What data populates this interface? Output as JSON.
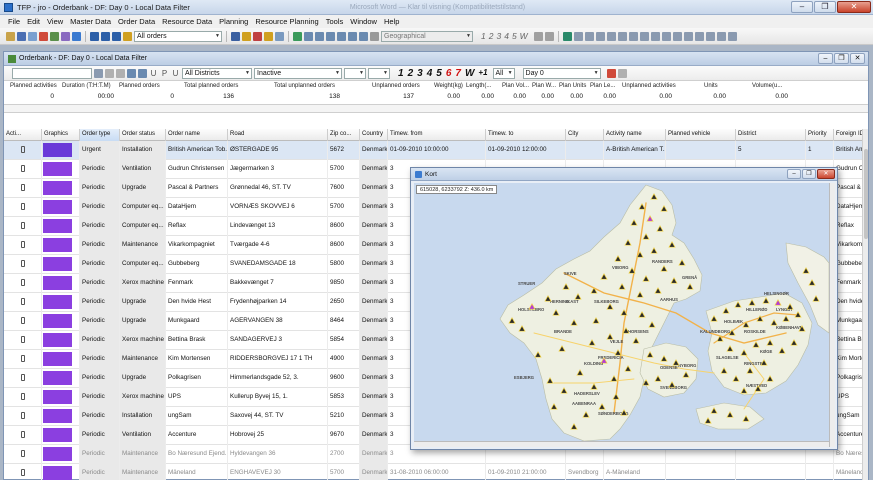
{
  "app": {
    "title": "TFP - jro - Orderbank - DF: Day 0 - Local Data Filter",
    "ghost_title": "Microsoft Word — Klar til visning (Kompatibilitetstilstand)",
    "minimize": "–",
    "restore": "❐",
    "close": "✕"
  },
  "menu": [
    "File",
    "Edit",
    "View",
    "Master Data",
    "Order Data",
    "Resource Data",
    "Planning",
    "Resource Planning",
    "Tools",
    "Window",
    "Help"
  ],
  "toolbar": {
    "orders_combo": "All orders",
    "geo_combo": "Geographical",
    "numbers": [
      "1",
      "2",
      "3",
      "4",
      "5",
      "W"
    ]
  },
  "orderbank": {
    "title": "Orderbank - DF: Day 0 - Local Data Filter",
    "minimize": "–",
    "restore": "❐",
    "close": "✕"
  },
  "filterbar": {
    "letters": [
      "U",
      "P",
      "U"
    ],
    "districts": "All Districts",
    "status": "Inactive",
    "numbers": [
      "1",
      "2",
      "3",
      "4",
      "5",
      "6",
      "7"
    ],
    "red_numbers": [
      "6",
      "7"
    ],
    "week": "W",
    "plus1": "+1",
    "all": "All",
    "day": "Day 0"
  },
  "summary": [
    {
      "label": "Planned activities",
      "value": "0"
    },
    {
      "label": "Duration (T:H:T.M)",
      "value": "00:00"
    },
    {
      "label": "Planned orders",
      "value": "0"
    },
    {
      "label": "Total planned orders",
      "value": "136"
    },
    {
      "label": "Total unplanned orders",
      "value": "138"
    },
    {
      "label": "Unplanned orders",
      "value": "137"
    },
    {
      "label": "Weight(kg)",
      "value": "0.00"
    },
    {
      "label": "Length(...",
      "value": "0.00"
    },
    {
      "label": "Plan Vol...",
      "value": "0.00"
    },
    {
      "label": "Plan W...",
      "value": "0.00"
    },
    {
      "label": "Plan Units",
      "value": "0.00"
    },
    {
      "label": "Plan Le...",
      "value": "0.00"
    },
    {
      "label": "Unplanned activities",
      "value": "0.00"
    },
    {
      "label": "Units",
      "value": "0.00"
    },
    {
      "label": "Volume(u...",
      "value": "0.00"
    }
  ],
  "columns": [
    "Acti...",
    "Graphics",
    "Order type",
    "Order status",
    "Order name",
    "Road",
    "Zip co...",
    "Country",
    "Timew. from",
    "Timew. to",
    "City",
    "Activity name",
    "Planned vehicle",
    "District",
    "Priority",
    "Foreign ID"
  ],
  "rows": [
    {
      "type": "Urgent",
      "status": "Installation",
      "name": "British American Tob...",
      "road": "ØSTERGADE 95",
      "zip": "5672",
      "country": "Denmark",
      "from": "01-09-2010 10:00:00",
      "to": "01-09-2010 12:00:00",
      "city": "",
      "activity": "A-British American T...",
      "vehicle": "",
      "district": "5",
      "priority": "1",
      "foreign": "British Ame",
      "color": "#6a3ad8"
    },
    {
      "type": "Periodic",
      "status": "Ventilation",
      "name": "Gudrun Christensen",
      "road": "Jægermarken 3",
      "zip": "5700",
      "country": "Denmark",
      "from": "3",
      "to": "",
      "city": "",
      "activity": "",
      "vehicle": "",
      "district": "",
      "priority": "",
      "foreign": "Gudrun C",
      "color": "#8b3fe0"
    },
    {
      "type": "Periodic",
      "status": "Upgrade",
      "name": "Pascal & Partners",
      "road": "Grønnedal 46, ST. TV",
      "zip": "7600",
      "country": "Denmark",
      "from": "3",
      "to": "",
      "city": "",
      "activity": "",
      "vehicle": "",
      "district": "",
      "priority": "",
      "foreign": "Pascal & P",
      "color": "#8b3fe0"
    },
    {
      "type": "Periodic",
      "status": "Computer eq...",
      "name": "DataHjem",
      "road": "VORNÆS SKOVVEJ 6",
      "zip": "5700",
      "country": "Denmark",
      "from": "3",
      "to": "",
      "city": "",
      "activity": "",
      "vehicle": "",
      "district": "",
      "priority": "",
      "foreign": "DataHjem",
      "color": "#8b3fe0"
    },
    {
      "type": "Periodic",
      "status": "Computer eq...",
      "name": "Reflax",
      "road": "Lindevænget 13",
      "zip": "8600",
      "country": "Denmark",
      "from": "3",
      "to": "",
      "city": "",
      "activity": "",
      "vehicle": "",
      "district": "",
      "priority": "",
      "foreign": "Reflax",
      "color": "#8b3fe0"
    },
    {
      "type": "Periodic",
      "status": "Maintenance",
      "name": "Vikarkompagniet",
      "road": "Tværgade 4-6",
      "zip": "8600",
      "country": "Denmark",
      "from": "3",
      "to": "",
      "city": "",
      "activity": "",
      "vehicle": "",
      "district": "",
      "priority": "",
      "foreign": "Vikarkom",
      "color": "#8b3fe0"
    },
    {
      "type": "Periodic",
      "status": "Computer eq...",
      "name": "Gubbeberg",
      "road": "SVANEDAMSGADE 18",
      "zip": "5800",
      "country": "Denmark",
      "from": "3",
      "to": "",
      "city": "",
      "activity": "",
      "vehicle": "",
      "district": "",
      "priority": "",
      "foreign": "Gubbeberg",
      "color": "#8b3fe0"
    },
    {
      "type": "Periodic",
      "status": "Xerox machine",
      "name": "Fenmark",
      "road": "Bakkevænget 7",
      "zip": "9850",
      "country": "Denmark",
      "from": "3",
      "to": "",
      "city": "",
      "activity": "",
      "vehicle": "",
      "district": "",
      "priority": "",
      "foreign": "Fenmark",
      "color": "#8b3fe0"
    },
    {
      "type": "Periodic",
      "status": "Upgrade",
      "name": "Den hvide Hest",
      "road": "Frydenhøjparken 14",
      "zip": "2650",
      "country": "Denmark",
      "from": "3",
      "to": "",
      "city": "",
      "activity": "",
      "vehicle": "",
      "district": "",
      "priority": "",
      "foreign": "Den hvide",
      "color": "#8b3fe0"
    },
    {
      "type": "Periodic",
      "status": "Upgrade",
      "name": "Munkgaard",
      "road": "AGERVANGEN 38",
      "zip": "8464",
      "country": "Denmark",
      "from": "3",
      "to": "",
      "city": "",
      "activity": "",
      "vehicle": "",
      "district": "",
      "priority": "",
      "foreign": "Munkgaar",
      "color": "#8b3fe0"
    },
    {
      "type": "Periodic",
      "status": "Xerox machine",
      "name": "Bettina Brask",
      "road": "SANDAGERVEJ 3",
      "zip": "5854",
      "country": "Denmark",
      "from": "3",
      "to": "",
      "city": "",
      "activity": "",
      "vehicle": "",
      "district": "",
      "priority": "",
      "foreign": "Bettina Br",
      "color": "#8b3fe0"
    },
    {
      "type": "Periodic",
      "status": "Maintenance",
      "name": "Kim Mortensen",
      "road": "RIDDERSBORGVEJ 17 1 TH",
      "zip": "4900",
      "country": "Denmark",
      "from": "3",
      "to": "",
      "city": "",
      "activity": "",
      "vehicle": "",
      "district": "",
      "priority": "",
      "foreign": "Kim Morte",
      "color": "#8b3fe0"
    },
    {
      "type": "Periodic",
      "status": "Upgrade",
      "name": "Polkagrisen",
      "road": "Himmerlandsgade 52, 3.",
      "zip": "9600",
      "country": "Denmark",
      "from": "3",
      "to": "",
      "city": "",
      "activity": "",
      "vehicle": "",
      "district": "",
      "priority": "",
      "foreign": "Polkagrise",
      "color": "#8b3fe0"
    },
    {
      "type": "Periodic",
      "status": "Xerox machine",
      "name": "UPS",
      "road": "Kullerup Byvej 15, 1.",
      "zip": "5853",
      "country": "Denmark",
      "from": "3",
      "to": "",
      "city": "",
      "activity": "",
      "vehicle": "",
      "district": "",
      "priority": "",
      "foreign": "UPS",
      "color": "#8b3fe0"
    },
    {
      "type": "Periodic",
      "status": "Installation",
      "name": "ungSam",
      "road": "Saxovej 44, ST. TV",
      "zip": "5210",
      "country": "Denmark",
      "from": "3",
      "to": "",
      "city": "",
      "activity": "",
      "vehicle": "",
      "district": "",
      "priority": "",
      "foreign": "ungSam",
      "color": "#8b3fe0"
    },
    {
      "type": "Periodic",
      "status": "Ventilation",
      "name": "Accenture",
      "road": "Hobrovej 25",
      "zip": "9670",
      "country": "Denmark",
      "from": "3",
      "to": "",
      "city": "",
      "activity": "",
      "vehicle": "",
      "district": "",
      "priority": "",
      "foreign": "Accenture",
      "color": "#8b3fe0"
    },
    {
      "type": "Periodic",
      "status": "Maintenance",
      "name": "Bo Næresund Ejend...",
      "road": "Hyldevangen 36",
      "zip": "2700",
      "country": "Denmark",
      "from": "3",
      "to": "",
      "city": "",
      "activity": "",
      "vehicle": "",
      "district": "",
      "priority": "",
      "foreign": "Bo Næresu",
      "color": "#8b3fe0"
    },
    {
      "type": "Periodic",
      "status": "Maintenance",
      "name": "Mäneland",
      "road": "ENGHAVEVEJ 30",
      "zip": "5700",
      "country": "Denmark",
      "from": "31-08-2010 06:00:00",
      "to": "01-09-2010 21:00:00",
      "city": "Svendborg",
      "activity": "A-Mäneland",
      "vehicle": "",
      "district": "",
      "priority": "",
      "foreign": "Mäneland",
      "color": "#8b3fe0"
    }
  ],
  "map": {
    "title": "Kort",
    "coords": "615028, 6233792 Z: 436.0 km",
    "minimize": "–",
    "restore": "❐",
    "close": "✕",
    "labels": [
      {
        "text": "VIBORG"
      },
      {
        "text": "RANDERS"
      },
      {
        "text": "SKIVE"
      },
      {
        "text": "AARHUS"
      },
      {
        "text": "HORSENS"
      },
      {
        "text": "VEJLE"
      },
      {
        "text": "KOLDING"
      },
      {
        "text": "ODENSE"
      },
      {
        "text": "FREDERICIA"
      },
      {
        "text": "SØNDERBORG"
      },
      {
        "text": "AABENRAA"
      },
      {
        "text": "HADERSLEV"
      },
      {
        "text": "SVENDBORG"
      },
      {
        "text": "HELSINGØR"
      },
      {
        "text": "HILLERØD"
      },
      {
        "text": "ROSKILDE"
      },
      {
        "text": "KØBENHAVN"
      },
      {
        "text": "KØGE"
      },
      {
        "text": "HOLBÆK"
      },
      {
        "text": "SLAGELSE"
      },
      {
        "text": "RINGSTED"
      },
      {
        "text": "NÆSTVED"
      },
      {
        "text": "STRUER"
      },
      {
        "text": "HERNING"
      },
      {
        "text": "IKAST"
      },
      {
        "text": "SILKEBORG"
      },
      {
        "text": "HOLSTEBRO"
      },
      {
        "text": "BRANDE"
      },
      {
        "text": "ESBJERG"
      },
      {
        "text": "GRENÅ"
      },
      {
        "text": "NYBORG"
      },
      {
        "text": "LYNGBY"
      },
      {
        "text": "KALUNDBORG"
      }
    ]
  }
}
